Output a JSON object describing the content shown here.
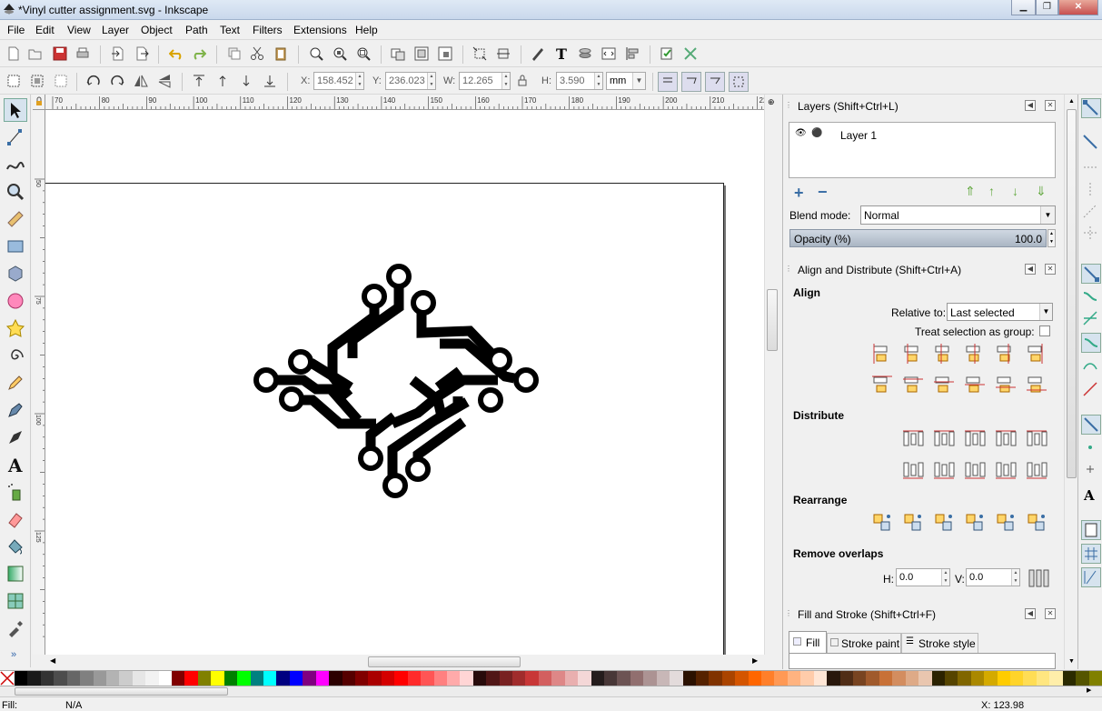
{
  "window": {
    "title": "*Vinyl cutter assignment.svg - Inkscape"
  },
  "menu": [
    "File",
    "Edit",
    "View",
    "Layer",
    "Object",
    "Path",
    "Text",
    "Filters",
    "Extensions",
    "Help"
  ],
  "toolcontrols": {
    "x_label": "X:",
    "x_value": "158.452",
    "y_label": "Y:",
    "y_value": "236.023",
    "w_label": "W:",
    "w_value": "12.265",
    "h_label": "H:",
    "h_value": "3.590",
    "unit": "mm"
  },
  "ruler": {
    "h_ticks": [
      "70",
      "80",
      "90",
      "100",
      "110",
      "120",
      "130",
      "140",
      "150",
      "160",
      "170",
      "180",
      "190",
      "200",
      "210",
      "220"
    ],
    "v_ticks": [
      "50",
      "75",
      "100",
      "125"
    ]
  },
  "layers": {
    "title": "Layers (Shift+Ctrl+L)",
    "items": [
      {
        "name": "Layer 1"
      }
    ],
    "blend_label": "Blend mode:",
    "blend_value": "Normal",
    "opacity_label": "Opacity (%)",
    "opacity_value": "100.0"
  },
  "align": {
    "title": "Align and Distribute (Shift+Ctrl+A)",
    "align_section": "Align",
    "relative_label": "Relative to:",
    "relative_value": "Last selected",
    "treat_group_label": "Treat selection as group:",
    "distribute_section": "Distribute",
    "rearrange_section": "Rearrange",
    "overlap_section": "Remove overlaps",
    "h_label": "H:",
    "h_value": "0.0",
    "v_label": "V:",
    "v_value": "0.0"
  },
  "fillstroke": {
    "title": "Fill and Stroke (Shift+Ctrl+F)",
    "tabs": [
      "Fill",
      "Stroke paint",
      "Stroke style"
    ]
  },
  "status": {
    "fill_label": "Fill:",
    "fill_value": "N/A",
    "coords": "X:  123.98"
  },
  "colors": {
    "accent": "#3a6ea5",
    "palette": [
      "#000000",
      "#1a1a1a",
      "#333333",
      "#4d4d4d",
      "#666666",
      "#808080",
      "#999999",
      "#b3b3b3",
      "#cccccc",
      "#e6e6e6",
      "#f2f2f2",
      "#ffffff",
      "#800000",
      "#ff0000",
      "#808000",
      "#ffff00",
      "#008000",
      "#00ff00",
      "#008080",
      "#00ffff",
      "#000080",
      "#0000ff",
      "#800080",
      "#ff00ff",
      "#2b0000",
      "#550000",
      "#800000",
      "#aa0000",
      "#d40000",
      "#ff0000",
      "#ff2a2a",
      "#ff5555",
      "#ff8080",
      "#ffaaaa",
      "#ffd5d5",
      "#280b0b",
      "#501616",
      "#782121",
      "#a02c2c",
      "#c83737",
      "#d35f5f",
      "#de8787",
      "#e9afaf",
      "#f4d7d7",
      "#241c1c",
      "#483737",
      "#6c5353",
      "#916f6f",
      "#ac9393",
      "#c8b7b7",
      "#e3dbdb",
      "#2b1100",
      "#552200",
      "#803300",
      "#aa4400",
      "#d45500",
      "#ff6600",
      "#ff7f2a",
      "#ff9955",
      "#ffb380",
      "#ffccaa",
      "#ffe6d5",
      "#28170b",
      "#502d16",
      "#784421",
      "#a05a2c",
      "#c87137",
      "#d38d5f",
      "#deaa87",
      "#e9c6af",
      "#2b2200",
      "#554400",
      "#806600",
      "#aa8800",
      "#d4aa00",
      "#ffcc00",
      "#ffd42a",
      "#ffdd55",
      "#ffe680",
      "#ffeeaa",
      "#2b2b00",
      "#555500",
      "#808000"
    ]
  }
}
